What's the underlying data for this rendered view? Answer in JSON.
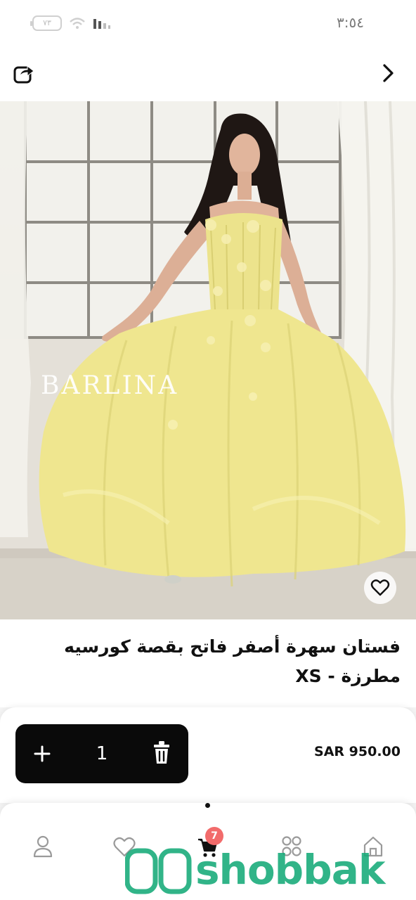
{
  "status_bar": {
    "battery": "٧٣",
    "time": "٣:٥٤"
  },
  "header": {
    "share_icon": "share-icon",
    "back_icon": "chevron-right-icon"
  },
  "product": {
    "image_watermark": "BARLINA",
    "title": "فستان سهرة أصفر فاتح بقصة كورسيه مطرزة - XS",
    "price": "SAR 950.00",
    "quantity": "1"
  },
  "bottom_nav": {
    "items": [
      {
        "name": "profile",
        "icon": "user-icon"
      },
      {
        "name": "favorites",
        "icon": "heart-icon"
      },
      {
        "name": "cart",
        "icon": "cart-icon",
        "badge": "7"
      },
      {
        "name": "categories",
        "icon": "grid-icon"
      },
      {
        "name": "home",
        "icon": "home-icon"
      }
    ]
  },
  "watermark_brand": "shobbak",
  "colors": {
    "accent": "#0a0a0a",
    "badge": "#f26b6b",
    "brand": "#14aa78",
    "dress": "#efe68f"
  }
}
